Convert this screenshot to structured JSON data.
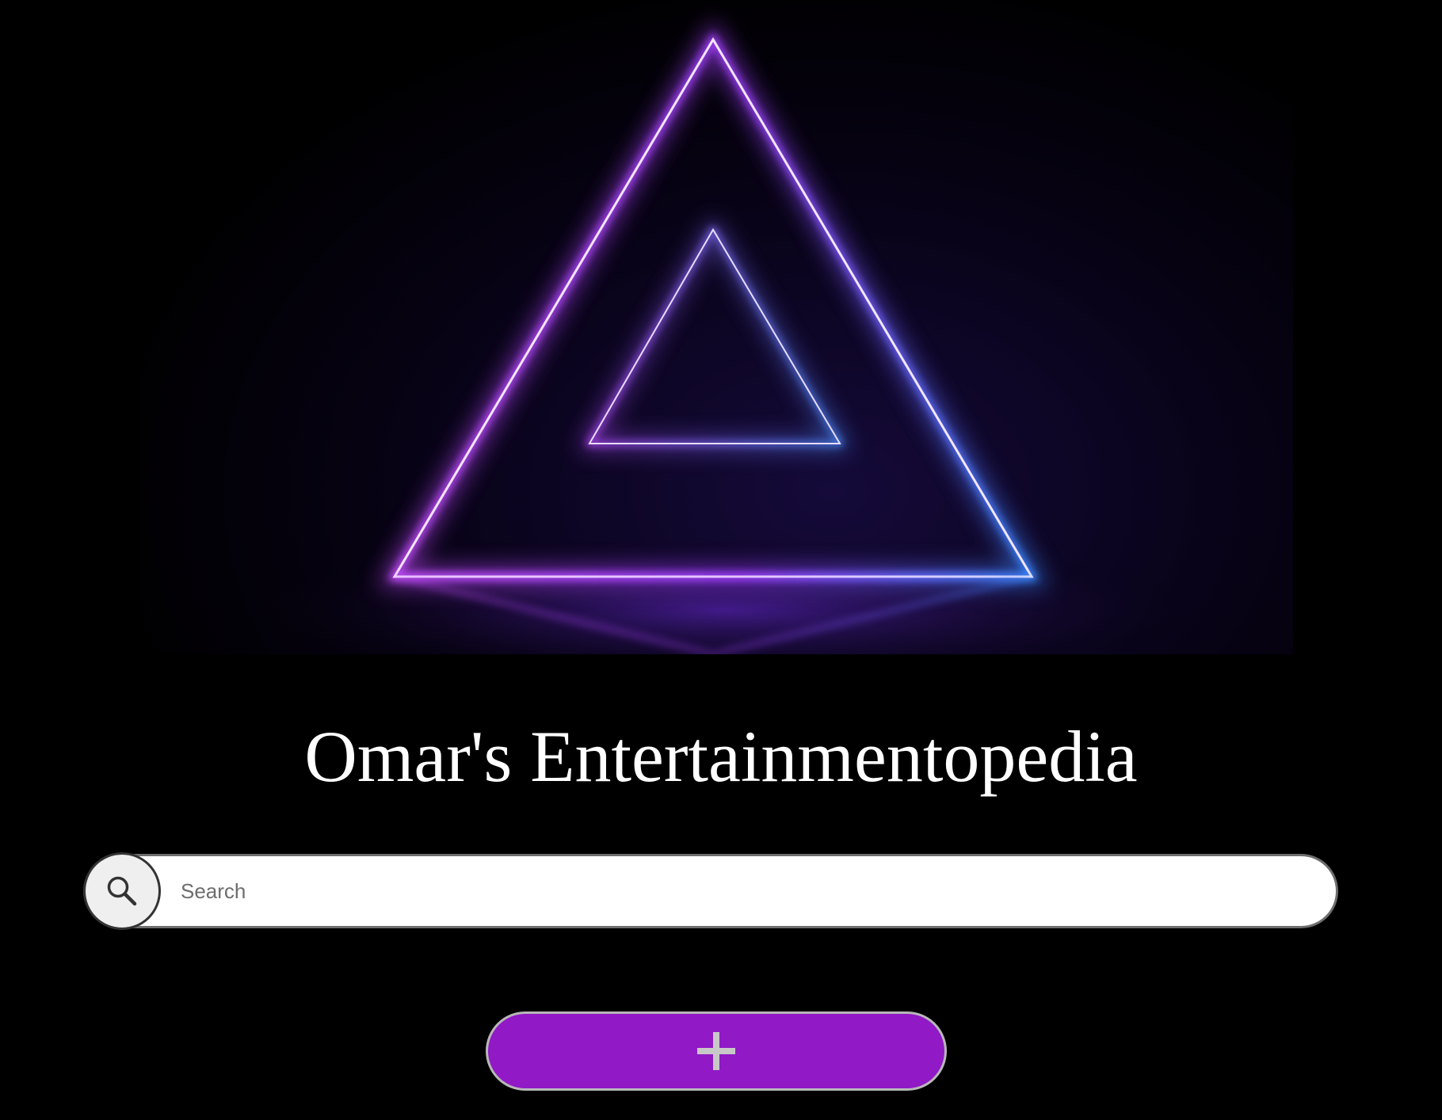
{
  "hero": {
    "image_name": "neon-triangle-image"
  },
  "header": {
    "title": "Omar's Entertainmentopedia"
  },
  "search": {
    "placeholder": "Search",
    "value": "",
    "icon": "search-icon"
  },
  "actions": {
    "add_icon": "plus-icon"
  },
  "colors": {
    "background": "#000000",
    "accent": "#9119c6",
    "neon_purple": "#b24bff",
    "neon_blue": "#3a7bff"
  }
}
